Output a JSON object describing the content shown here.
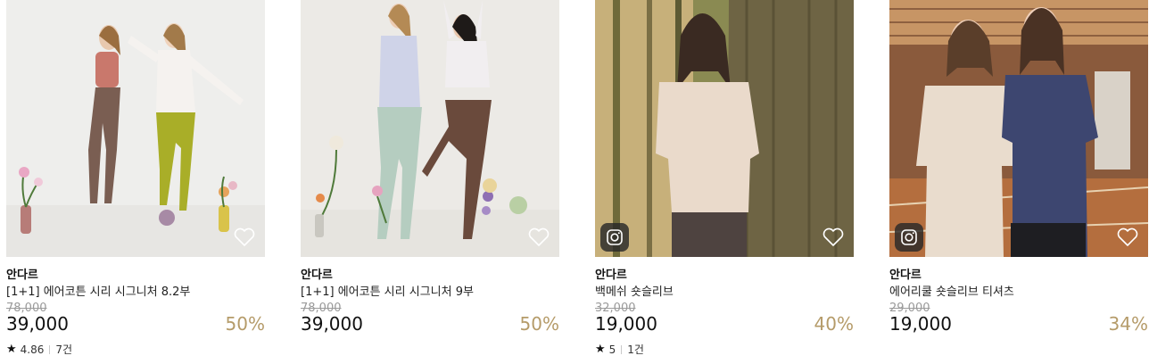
{
  "products": [
    {
      "brand": "안다르",
      "name": "[1+1] 에어코튼 시리 시그니처 8.2부",
      "original_price": "78,000",
      "price": "39,000",
      "discount": "50%",
      "rating": "4.86",
      "review_count": "7건",
      "has_instagram": false,
      "favorite_icon": "heart-outline-icon"
    },
    {
      "brand": "안다르",
      "name": "[1+1] 에어코튼 시리 시그니처 9부",
      "original_price": "78,000",
      "price": "39,000",
      "discount": "50%",
      "rating": "",
      "review_count": "",
      "has_instagram": false,
      "favorite_icon": "heart-outline-icon"
    },
    {
      "brand": "안다르",
      "name": "백메쉬 숏슬리브",
      "original_price": "32,000",
      "price": "19,000",
      "discount": "40%",
      "rating": "5",
      "review_count": "1건",
      "has_instagram": true,
      "favorite_icon": "heart-outline-icon"
    },
    {
      "brand": "안다르",
      "name": "에어리쿨 숏슬리브 티셔츠",
      "original_price": "29,000",
      "price": "19,000",
      "discount": "34%",
      "rating": "",
      "review_count": "",
      "has_instagram": true,
      "favorite_icon": "heart-outline-icon"
    }
  ],
  "colors": {
    "discount": "#b59b69",
    "strike_price": "#9a9a9a",
    "text": "#111111"
  }
}
